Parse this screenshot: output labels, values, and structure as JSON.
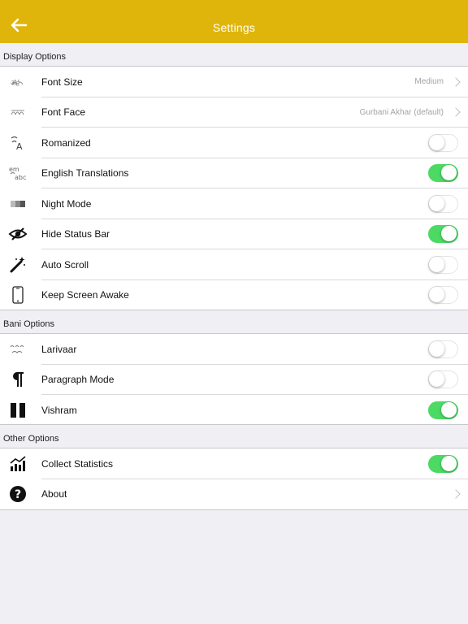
{
  "header": {
    "title": "Settings"
  },
  "colors": {
    "header": "#dfb50b",
    "toggle_on": "#4cd964"
  },
  "sections": [
    {
      "label": "Display Options",
      "rows": [
        {
          "icon": "font-size-icon",
          "label": "Font Size",
          "value": "Medium",
          "chevron": true
        },
        {
          "icon": "font-face-icon",
          "label": "Font Face",
          "value": "Gurbani Akhar (default)",
          "chevron": true
        },
        {
          "icon": "romanized-icon",
          "label": "Romanized",
          "toggle": false
        },
        {
          "icon": "english-translations-icon",
          "label": "English Translations",
          "toggle": true
        },
        {
          "icon": "night-mode-icon",
          "label": "Night Mode",
          "toggle": false
        },
        {
          "icon": "hide-eye-icon",
          "label": "Hide Status Bar",
          "toggle": true
        },
        {
          "icon": "magic-wand-icon",
          "label": "Auto Scroll",
          "toggle": false
        },
        {
          "icon": "phone-icon",
          "label": "Keep Screen Awake",
          "toggle": false
        }
      ]
    },
    {
      "label": "Bani Options",
      "rows": [
        {
          "icon": "larivaar-icon",
          "label": "Larivaar",
          "toggle": false
        },
        {
          "icon": "pilcrow-icon",
          "label": "Paragraph Mode",
          "toggle": false
        },
        {
          "icon": "pause-icon",
          "label": "Vishram",
          "toggle": true
        }
      ]
    },
    {
      "label": "Other Options",
      "rows": [
        {
          "icon": "statistics-chart-icon",
          "label": "Collect Statistics",
          "toggle": true
        },
        {
          "icon": "question-circle-icon",
          "label": "About",
          "chevron": true
        }
      ]
    }
  ]
}
